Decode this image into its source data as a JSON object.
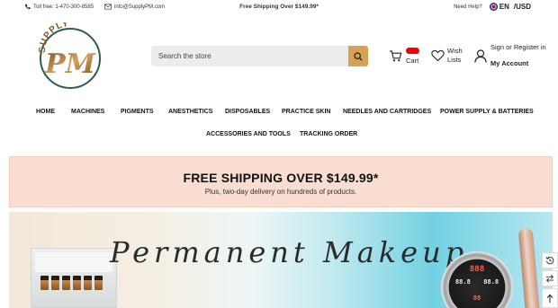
{
  "topbar": {
    "phone": "Toll free: 1-470-300-8585",
    "email": "info@SupplyPM.com",
    "promo": "Free Shipping Over $149.99*",
    "help": "Need Help?",
    "language": "EN",
    "currency": "/USD"
  },
  "logo": {
    "top_text": "SUPPLY",
    "monogram": "PM"
  },
  "search": {
    "placeholder": "Search the store"
  },
  "header": {
    "cart_label": "Cart",
    "wishlist_label": "Wish Lists",
    "account_line1": "Sign or Register in",
    "account_line2": "My Account"
  },
  "nav": {
    "row1": [
      "HOME",
      "MACHINES",
      "PIGMENTS",
      "ANESTHETICS",
      "DISPOSABLES",
      "PRACTICE SKIN",
      "NEEDLES AND CARTRIDGES",
      "POWER SUPPLY & BATTERIES"
    ],
    "row2": [
      "ACCESSORIES AND TOOLS",
      "TRACKING ORDER"
    ]
  },
  "banner": {
    "title": "FREE SHIPPING OVER $149.99*",
    "subtitle": "Plus, two-day delivery on hundreds of products."
  },
  "hero": {
    "script_text": "Permanent Makeup",
    "kit_brand": "",
    "device_top": "888",
    "device_mid_left": "88.8",
    "device_mid_right": "88.8",
    "device_bottom": "88"
  },
  "colors": {
    "accent": "#d8a253",
    "banner_bg": "#f8ddd0",
    "badge": "#ee0000",
    "logo_ring": "#2f5a55"
  }
}
